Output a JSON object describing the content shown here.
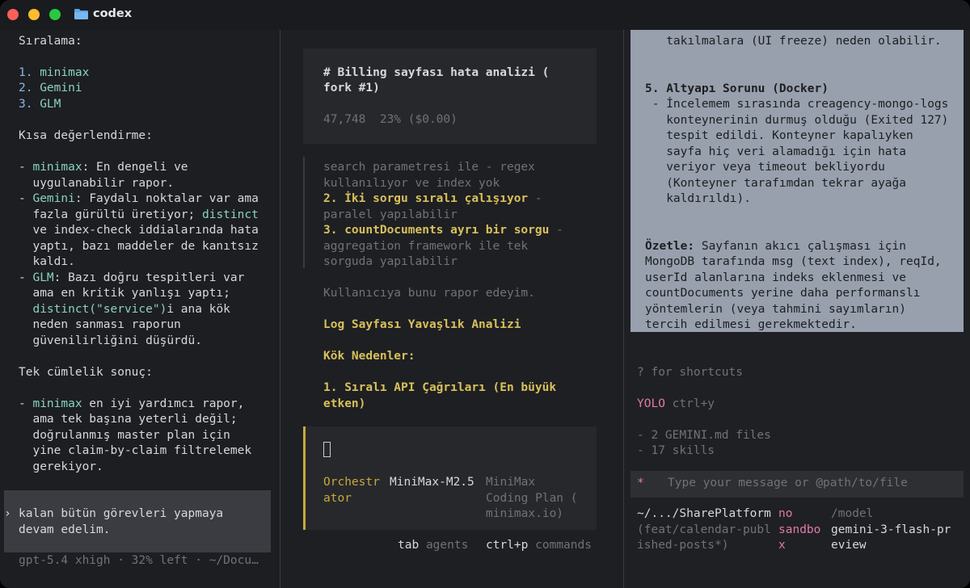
{
  "window": {
    "title": "codex"
  },
  "left": {
    "heading": "Sıralama:",
    "ranking": [
      {
        "num": "1.",
        "name": "minimax"
      },
      {
        "num": "2.",
        "name": "Gemini"
      },
      {
        "num": "3.",
        "name": "GLM"
      }
    ],
    "eval_heading": "Kısa değerlendirme:",
    "minimax_rest1": ": En dengeli ve",
    "minimax_rest2": "  uygulanabilir rapor.",
    "gemini_rest1": ": Faydalı noktalar var ama",
    "gemini_rest2a": "  fazla gürültü üretiyor; ",
    "gemini_distinct": "distinct",
    "gemini_rest3": "  ve index-check iddialarında hata",
    "gemini_rest4": "  yaptı, bazı maddeler de kanıtsız",
    "gemini_rest5": "  kaldı.",
    "glm_rest1": ": Bazı doğru tespitleri var",
    "glm_rest2": "  ama en kritik yanlışı yaptı;",
    "glm_code": "distinct(\"service\")",
    "glm_rest3b": "i ana kök",
    "glm_rest4": "  neden sanması raporun",
    "glm_rest5": "  güvenilirliğini düşürdü.",
    "summary_heading": "Tek cümlelik sonuç:",
    "summary_rest1": " en iyi yardımcı rapor,",
    "summary_rest2": "  ama tek başına yeterli değil;",
    "summary_rest3": "  doğrulanmış master plan için",
    "summary_rest4": "  yine claim-by-claim filtrelemek",
    "summary_rest5": "  gerekiyor.",
    "dash": "- ",
    "user_prompt1": "kalan bütün görevleri yapmaya",
    "user_prompt2": "devam edelim.",
    "chevron": "›",
    "status": "gpt-5.4 xhigh · 32% left · ~/Docu…"
  },
  "middle": {
    "card_title1": "# Billing sayfası hata analizi (",
    "card_title2": "fork #1)",
    "card_stats": "47,748  23% ($0.00)",
    "q1": "search parametresi ile - regex",
    "q2": "kullanılıyor ve index yok",
    "q3a": "2. İki sorgu sıralı çalışıyor",
    "q3b": " -",
    "q4": "paralel yapılabilir",
    "q5a": "3. countDocuments ayrı bir sorgu",
    "q5b": " -",
    "q6": "aggregation framework ile tek",
    "q7": "sorguda yapılabilir",
    "report": "Kullanıcıya bunu rapor edeyim.",
    "h1": "Log Sayfası Yavaşlık Analizi",
    "h2": "Kök Nedenler:",
    "h3a": "1. Sıralı API Çağrıları (En büyük",
    "h3b": "etken)",
    "agent_col1a": "Orchestr",
    "agent_col1b": "ator",
    "agent_col2": "MiniMax-M2.5",
    "agent_col3a": "MiniMax",
    "agent_col3b": "Coding Plan (",
    "agent_col3c": "minimax.io)",
    "tab_key": "tab",
    "tab_label": "agents",
    "ctrl_key": "ctrl+p",
    "ctrl_label": "commands"
  },
  "right": {
    "s1": "   takılmalara (UI freeze) neden olabilir.",
    "s2": "5. Altyapı Sorunu (Docker)",
    "s3": " - İncelemem sırasında creagency-mongo-logs",
    "s4": "   konteynerinin durmuş olduğu (Exited 127)",
    "s5": "   tespit edildi. Konteyner kapalıyken",
    "s6": "   sayfa hiç veri alamadığı için hata",
    "s7": "   veriyor veya timeout bekliyordu",
    "s8": "   (Konteyner tarafımdan tekrar ayağa",
    "s9": "   kaldırıldı).",
    "s10a": "Özetle:",
    "s10b": " Sayfanın akıcı çalışması için",
    "s11": "MongoDB tarafında msg (text index), reqId,",
    "s12": "userId alanlarına indeks eklenmesi ve",
    "s13": "countDocuments yerine daha performanslı",
    "s14": "yöntemlerin (veya tahmini sayımların)",
    "s15": "tercih edilmesi gerekmektedir.",
    "shortcuts": "? for shortcuts",
    "yolo": "YOLO",
    "yolo_key": " ctrl+y",
    "files1": "- 2 GEMINI.md files",
    "files2": "- 17 skills",
    "input_star": "*",
    "input_placeholder": "Type your message or @path/to/file",
    "path1": "~/.../SharePlatform",
    "path2": "(feat/calendar-publ",
    "path3": "ished-posts*)",
    "sandbox1": "no",
    "sandbox2": "sandbo",
    "sandbox3": "x",
    "model1": "/model",
    "model2": "gemini-3-flash-pr",
    "model3": "eview"
  },
  "colors": {
    "accent_teal": "#8ad2c0",
    "accent_blue": "#86b7ea",
    "accent_yellow": "#d8c05a",
    "accent_pink": "#e07aa8",
    "background": "#1c1d21"
  },
  "icons": [
    "folder-icon"
  ]
}
